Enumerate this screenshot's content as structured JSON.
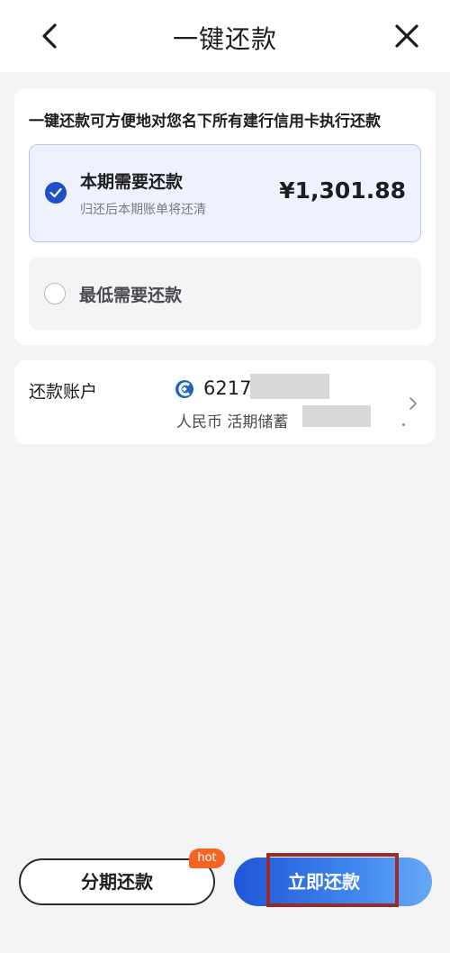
{
  "header": {
    "title": "一键还款",
    "back_icon": "chevron-left-icon",
    "close_icon": "close-icon"
  },
  "intro_text": "一键还款可方便地对您名下所有建行信用卡执行还款",
  "options": {
    "current": {
      "label": "本期需要还款",
      "sub": "归还后本期账单将还清",
      "amount": "¥1,301.88",
      "selected": true
    },
    "minimum": {
      "label": "最低需要还款",
      "selected": false
    }
  },
  "account": {
    "label": "还款账户",
    "number_prefix": "6217",
    "type": "人民币 活期储蓄",
    "bank_icon": "ccb-logo-icon"
  },
  "buttons": {
    "installment": "分期还款",
    "hot_badge": "hot",
    "pay_now": "立即还款"
  },
  "colors": {
    "accent": "#1f4fc7",
    "badge": "#f26522",
    "highlight": "#9a2b2b"
  }
}
